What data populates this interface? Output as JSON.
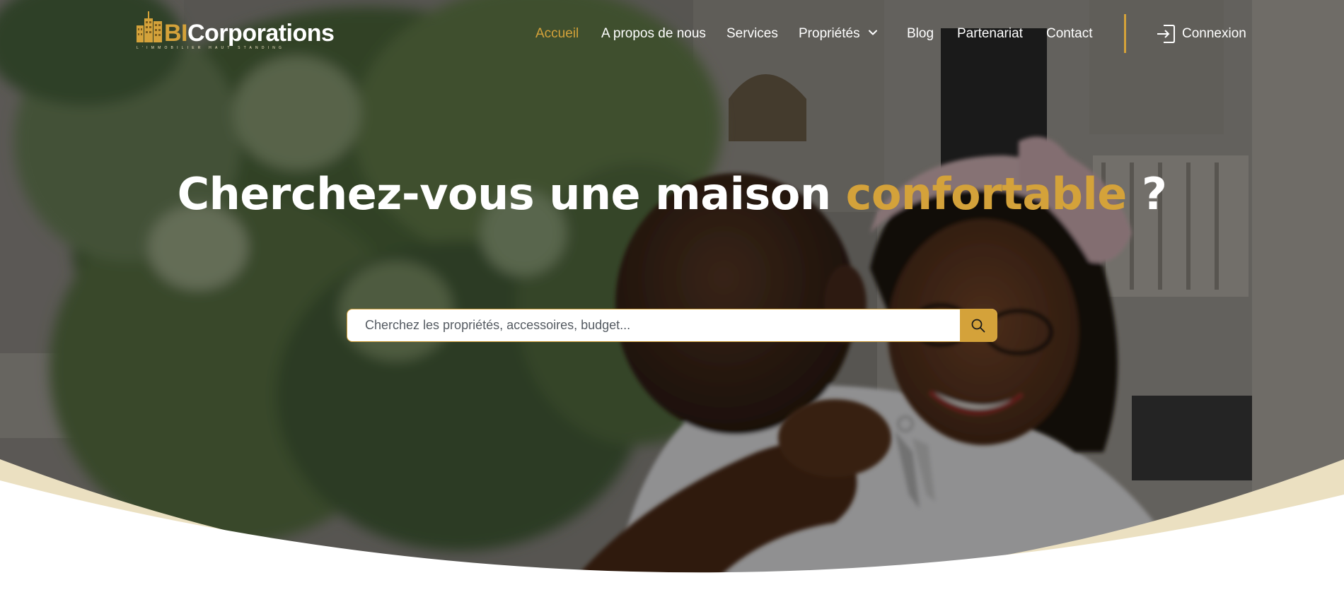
{
  "brand": {
    "name_prefix": "BI",
    "name_suffix": "Corporations",
    "tagline": "L'IMMOBILIER HAUT STANDING",
    "accent_color": "#d4a23a"
  },
  "nav": {
    "items": [
      {
        "label": "Accueil",
        "active": true
      },
      {
        "label": "A propos de nous",
        "active": false
      },
      {
        "label": "Services",
        "active": false
      },
      {
        "label": "Propriétés",
        "active": false,
        "icon": "chevron-down-icon"
      },
      {
        "label": "Blog",
        "active": false
      },
      {
        "label": "Partenariat",
        "active": false
      },
      {
        "label": "Contact",
        "active": false
      }
    ],
    "login_label": "Connexion",
    "login_icon": "login-icon"
  },
  "hero": {
    "headline_start": "Cherchez-vous une maison ",
    "headline_accent": "confortable",
    "headline_end": " ?",
    "curve_color": "#ebe0c1"
  },
  "search": {
    "placeholder": "Cherchez les propriétés, accessoires, budget...",
    "value": "",
    "button_icon": "search-icon"
  }
}
